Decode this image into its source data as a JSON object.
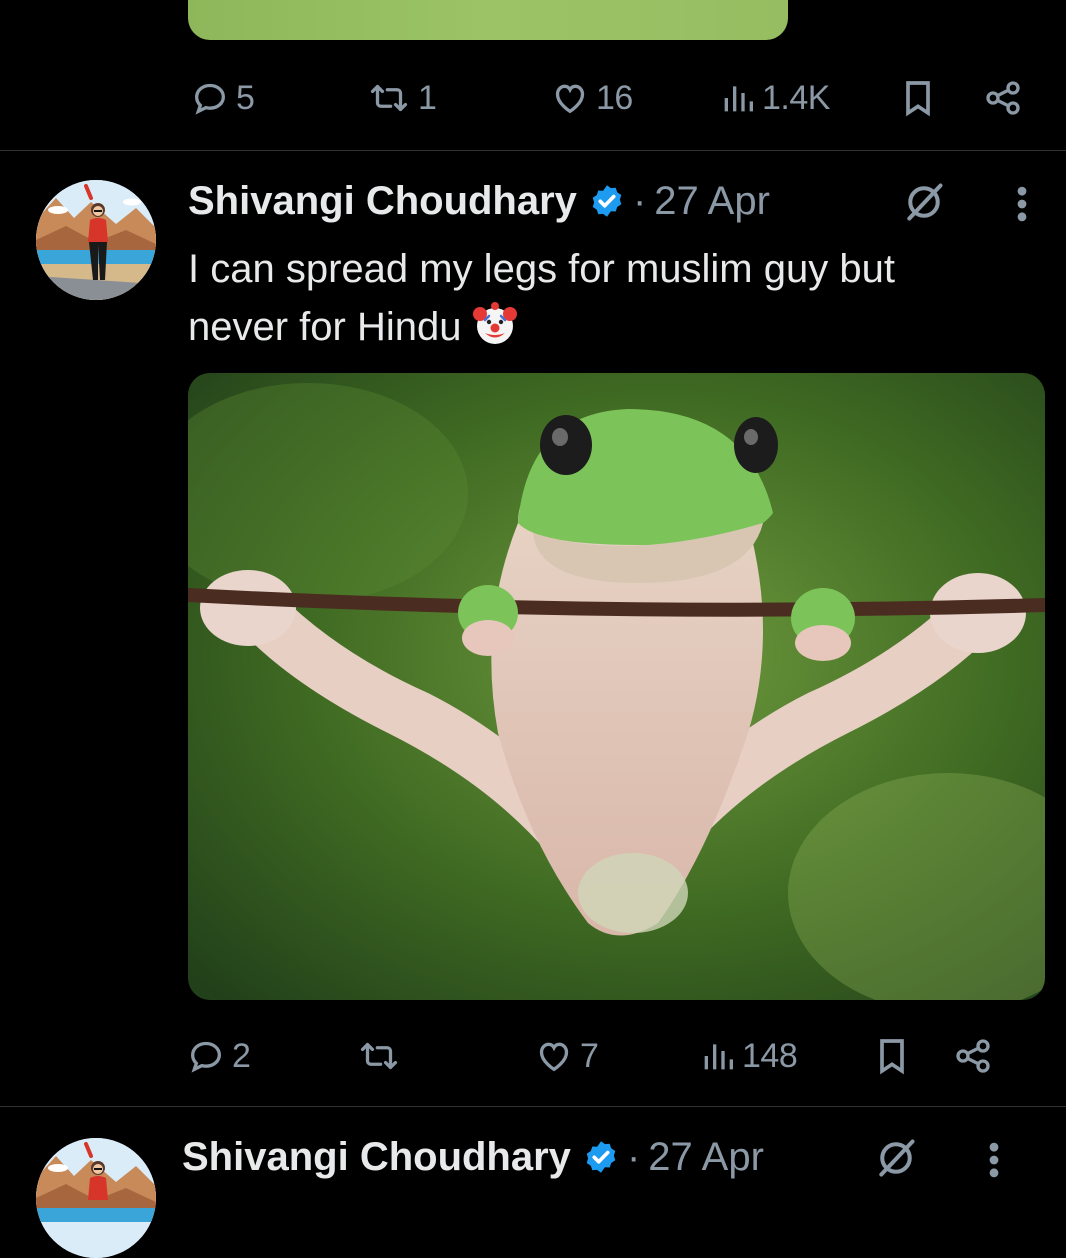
{
  "feed": {
    "previous_tweet": {
      "actions": {
        "replies": "5",
        "reposts": "1",
        "likes": "16",
        "views": "1.4K"
      }
    },
    "tweet": {
      "display_name": "Shivangi Choudhary",
      "separator": "·",
      "date": "27 Apr",
      "text_line1": "I can spread my legs for muslim guy but",
      "text_line2": "never for Hindu",
      "emoji_icon": "clown-face-icon",
      "actions": {
        "replies": "2",
        "reposts": "",
        "likes": "7",
        "views": "148"
      }
    },
    "next_tweet": {
      "display_name": "Shivangi Choudhary",
      "separator": "·",
      "date": "27 Apr"
    }
  },
  "icons": {
    "reply": "reply-icon",
    "repost": "repost-icon",
    "like": "heart-icon",
    "views": "views-icon",
    "bookmark": "bookmark-icon",
    "share": "share-icon",
    "verified": "verified-badge-icon",
    "grok": "grok-icon",
    "more": "more-icon"
  },
  "colors": {
    "background": "#000000",
    "text_primary": "#e7e9ea",
    "text_secondary": "#8b98a5",
    "verified_blue": "#1d9bf0",
    "divider": "#2f3336"
  }
}
